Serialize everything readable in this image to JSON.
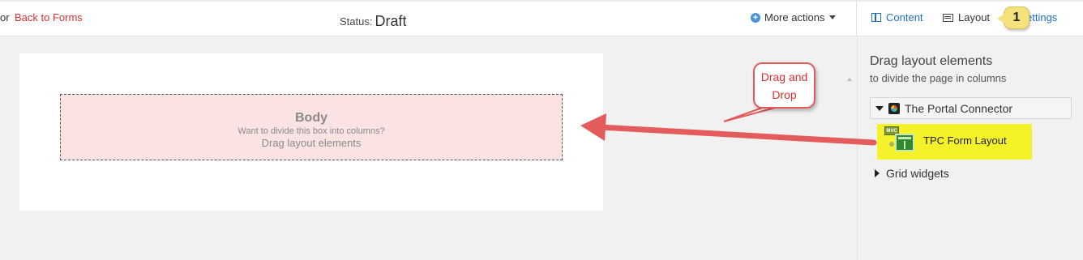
{
  "topbar": {
    "crumb_prefix": "or",
    "back_link": "Back to Forms",
    "status_label": "Status:",
    "status_value": "Draft",
    "more_actions": "More actions",
    "tabs": {
      "content": "Content",
      "layout": "Layout",
      "settings": "ettings"
    },
    "callout_number": "1",
    "callout_color": "#f5e27a"
  },
  "page": {
    "body_title": "Body",
    "body_subtitle": "Want to divide this box into columns?",
    "body_hint": "Drag layout elements"
  },
  "panel": {
    "title": "Drag layout elements",
    "subtitle": "to divide the page in columns",
    "group_label": "The Portal Connector",
    "widget_label": "TPC Form Layout",
    "widget_badge": "MVC",
    "grid_widgets_label": "Grid widgets"
  },
  "annotation": {
    "drag_line1": "Drag and",
    "drag_line2": "Drop",
    "arrow_color": "#e45b5b",
    "highlight_color": "#f6f22a"
  },
  "icons": {
    "plus": "plus-circle-icon",
    "caret": "caret-down-icon",
    "columns": "columns-icon",
    "list": "list-icon",
    "expand": "triangle-down-icon",
    "collapse": "triangle-right-icon",
    "logo": "portal-connector-logo-icon",
    "widget": "mvc-layout-widget-icon"
  }
}
